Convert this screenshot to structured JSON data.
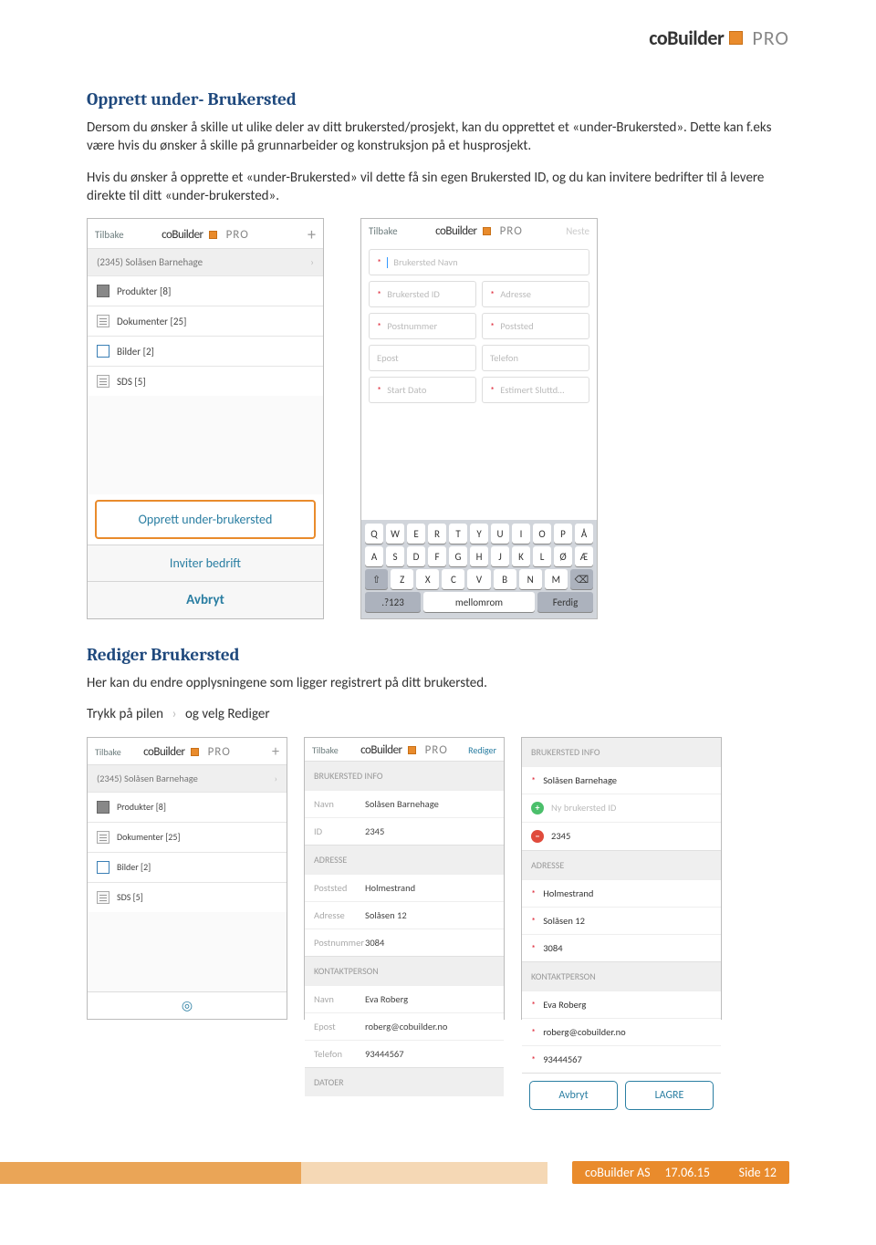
{
  "header_logo": {
    "co": "coBuilder",
    "pro": "PRO"
  },
  "section1": {
    "heading": "Opprett under- Brukersted",
    "para1": "Dersom du ønsker å skille ut ulike deler av ditt brukersted/prosjekt, kan du opprettet et «under-Brukersted». Dette kan f.eks være hvis du ønsker å skille på grunnarbeider og konstruksjon på et husprosjekt.",
    "para2": "Hvis du ønsker å opprette et «under-Brukersted» vil dette få sin egen Brukersted ID, og du kan invitere bedrifter til å levere direkte til ditt «under-brukersted»."
  },
  "shot1": {
    "back": "Tilbake",
    "plus": "+",
    "title": "(2345) Solåsen Barnehage",
    "items": [
      {
        "label": "Produkter [8]",
        "icon": "gray"
      },
      {
        "label": "Dokumenter [25]",
        "icon": "doc"
      },
      {
        "label": "Bilder [2]",
        "icon": "blue"
      },
      {
        "label": "SDS [5]",
        "icon": "doc"
      }
    ],
    "btn1": "Opprett under-brukersted",
    "btn2": "Inviter bedrift",
    "btn3": "Avbryt"
  },
  "shot2": {
    "back": "Tilbake",
    "next": "Neste",
    "fields": {
      "name": "Brukersted Navn",
      "id": "Brukersted ID",
      "addr": "Adresse",
      "post": "Postnummer",
      "city": "Poststed",
      "email": "Epost",
      "phone": "Telefon",
      "start": "Start Dato",
      "end": "Estimert Sluttd…"
    },
    "kb_rows": [
      [
        "Q",
        "W",
        "E",
        "R",
        "T",
        "Y",
        "U",
        "I",
        "O",
        "P",
        "Å"
      ],
      [
        "A",
        "S",
        "D",
        "F",
        "G",
        "H",
        "J",
        "K",
        "L",
        "Ø",
        "Æ"
      ]
    ],
    "kb_row3": [
      "Z",
      "X",
      "C",
      "V",
      "B",
      "N",
      "M"
    ],
    "kb_shift": "⇧",
    "kb_del": "⌫",
    "kb_bottom": {
      "num": ".?123",
      "space": "mellomrom",
      "done": "Ferdig"
    }
  },
  "section2": {
    "heading": "Rediger Brukersted",
    "para1": "Her kan du endre opplysningene som ligger registrert på ditt brukersted.",
    "para2_a": "Trykk på pilen",
    "para2_b": "og velg Rediger"
  },
  "shot3": {
    "back": "Tilbake",
    "plus": "+",
    "title": "(2345) Solåsen Barnehage",
    "items": [
      {
        "label": "Produkter [8]",
        "icon": "gray"
      },
      {
        "label": "Dokumenter [25]",
        "icon": "doc"
      },
      {
        "label": "Bilder [2]",
        "icon": "blue"
      },
      {
        "label": "SDS [5]",
        "icon": "doc"
      }
    ],
    "geo": "◎"
  },
  "shot4": {
    "back": "Tilbake",
    "edit": "Rediger",
    "sec1": "BRUKERSTED INFO",
    "rows1": [
      {
        "lab": "Navn",
        "val": "Solåsen Barnehage"
      },
      {
        "lab": "ID",
        "val": "2345"
      }
    ],
    "sec2": "ADRESSE",
    "rows2": [
      {
        "lab": "Poststed",
        "val": "Holmestrand"
      },
      {
        "lab": "Adresse",
        "val": "Solåsen 12"
      },
      {
        "lab": "Postnummer",
        "val": "3084"
      }
    ],
    "sec3": "KONTAKTPERSON",
    "rows3": [
      {
        "lab": "Navn",
        "val": "Eva Roberg"
      },
      {
        "lab": "Epost",
        "val": "roberg@cobuilder.no",
        "blue": true
      },
      {
        "lab": "Telefon",
        "val": "93444567"
      }
    ],
    "sec4": "DATOER"
  },
  "shot5": {
    "sec1": "BRUKERSTED INFO",
    "r1": "Solåsen Barnehage",
    "r2": "Ny brukersted ID",
    "r3": "2345",
    "sec2": "ADRESSE",
    "r4": "Holmestrand",
    "r5": "Solåsen 12",
    "r6": "3084",
    "sec3": "KONTAKTPERSON",
    "r7": "Eva Roberg",
    "r8": "roberg@cobuilder.no",
    "r9": "93444567",
    "cancel": "Avbryt",
    "save": "LAGRE"
  },
  "footer": {
    "left": "coBuilder AS",
    "mid": "17.06.15",
    "right": "Side 12"
  }
}
